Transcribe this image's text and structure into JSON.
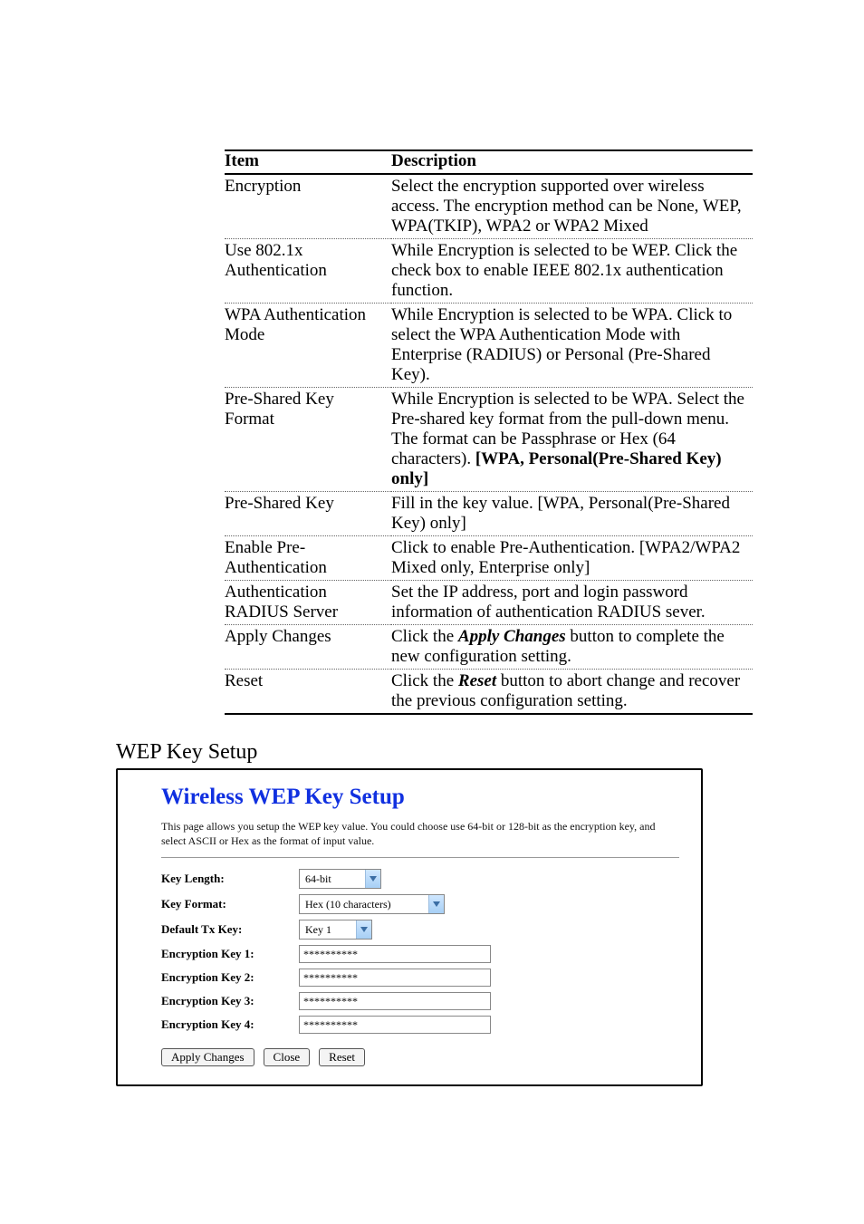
{
  "table": {
    "headers": {
      "item": "Item",
      "description": "Description"
    },
    "rows": [
      {
        "item": "Encryption",
        "desc": "Select the encryption supported over wireless access. The encryption method can be None, WEP, WPA(TKIP), WPA2 or WPA2 Mixed"
      },
      {
        "item": "Use 802.1x Authentication",
        "desc": "While Encryption is selected to be WEP. Click the check box to enable IEEE 802.1x authentication function."
      },
      {
        "item": "WPA Authentication Mode",
        "desc": "While Encryption is selected to be WPA. Click to select the WPA Authentication Mode with Enterprise (RADIUS) or Personal (Pre-Shared Key)."
      },
      {
        "item": "Pre-Shared Key Format",
        "desc_pre": "While Encryption is selected to be WPA. Select the Pre-shared key format from the pull-down menu. The format can be Passphrase or Hex (64 characters). ",
        "desc_bold": "[WPA, Personal(Pre-Shared Key) only]"
      },
      {
        "item": "Pre-Shared Key",
        "desc": "Fill in the key value. [WPA, Personal(Pre-Shared Key) only]"
      },
      {
        "item": "Enable Pre-Authentication",
        "desc": "Click to enable Pre-Authentication. [WPA2/WPA2 Mixed only, Enterprise only]"
      },
      {
        "item": "Authentication RADIUS Server",
        "desc": "Set the IP address, port and login password information of authentication RADIUS sever."
      },
      {
        "item": "Apply Changes",
        "desc_pre": "Click the ",
        "desc_bi": "Apply Changes",
        "desc_post": " button to complete the new configuration setting."
      },
      {
        "item": "Reset",
        "desc_pre": "Click the ",
        "desc_bi": "Reset",
        "desc_post": " button to abort change and recover the previous configuration setting."
      }
    ]
  },
  "section_title": "WEP Key Setup",
  "panel": {
    "title": "Wireless WEP Key Setup",
    "intro": "This page allows you setup the WEP key value. You could choose use 64-bit or 128-bit as the encryption key, and select ASCII or Hex as the format of input value.",
    "fields": {
      "key_length": {
        "label": "Key Length:",
        "value": "64-bit"
      },
      "key_format": {
        "label": "Key Format:",
        "value": "Hex (10 characters)"
      },
      "default_tx": {
        "label": "Default Tx Key:",
        "value": "Key 1"
      },
      "key1": {
        "label": "Encryption Key 1:",
        "value": "**********"
      },
      "key2": {
        "label": "Encryption Key 2:",
        "value": "**********"
      },
      "key3": {
        "label": "Encryption Key 3:",
        "value": "**********"
      },
      "key4": {
        "label": "Encryption Key 4:",
        "value": "**********"
      }
    },
    "buttons": {
      "apply": "Apply Changes",
      "close": "Close",
      "reset": "Reset"
    }
  }
}
